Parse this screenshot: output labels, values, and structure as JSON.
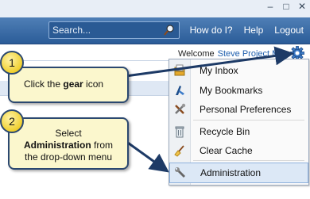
{
  "header": {
    "search_placeholder": "Search...",
    "links": [
      "How do I?",
      "Help",
      "Logout"
    ]
  },
  "welcome": {
    "label": "Welcome",
    "user": "Steve Project Ma"
  },
  "menu": {
    "items": [
      {
        "label": "My Inbox",
        "icon": "inbox-icon"
      },
      {
        "label": "My Bookmarks",
        "icon": "bookmark-icon"
      },
      {
        "label": "Personal Preferences",
        "icon": "tools-icon"
      },
      {
        "label": "Recycle Bin",
        "icon": "recycle-bin-icon"
      },
      {
        "label": "Clear Cache",
        "icon": "broom-icon"
      },
      {
        "label": "Administration",
        "icon": "wrench-icon"
      }
    ],
    "selected": "Administration"
  },
  "callouts": [
    {
      "number": "1",
      "pre": "Click the ",
      "bold": "gear",
      "post": " icon"
    },
    {
      "number": "2",
      "line1": "Select",
      "bold": "Administration",
      "line2": " from",
      "line3": "the drop-down menu"
    }
  ],
  "colors": {
    "header": "#2b5c98",
    "callout_bg": "#fbf7cd",
    "callout_border": "#2b4870",
    "badge": "#f0d030",
    "link": "#1f5fae"
  }
}
